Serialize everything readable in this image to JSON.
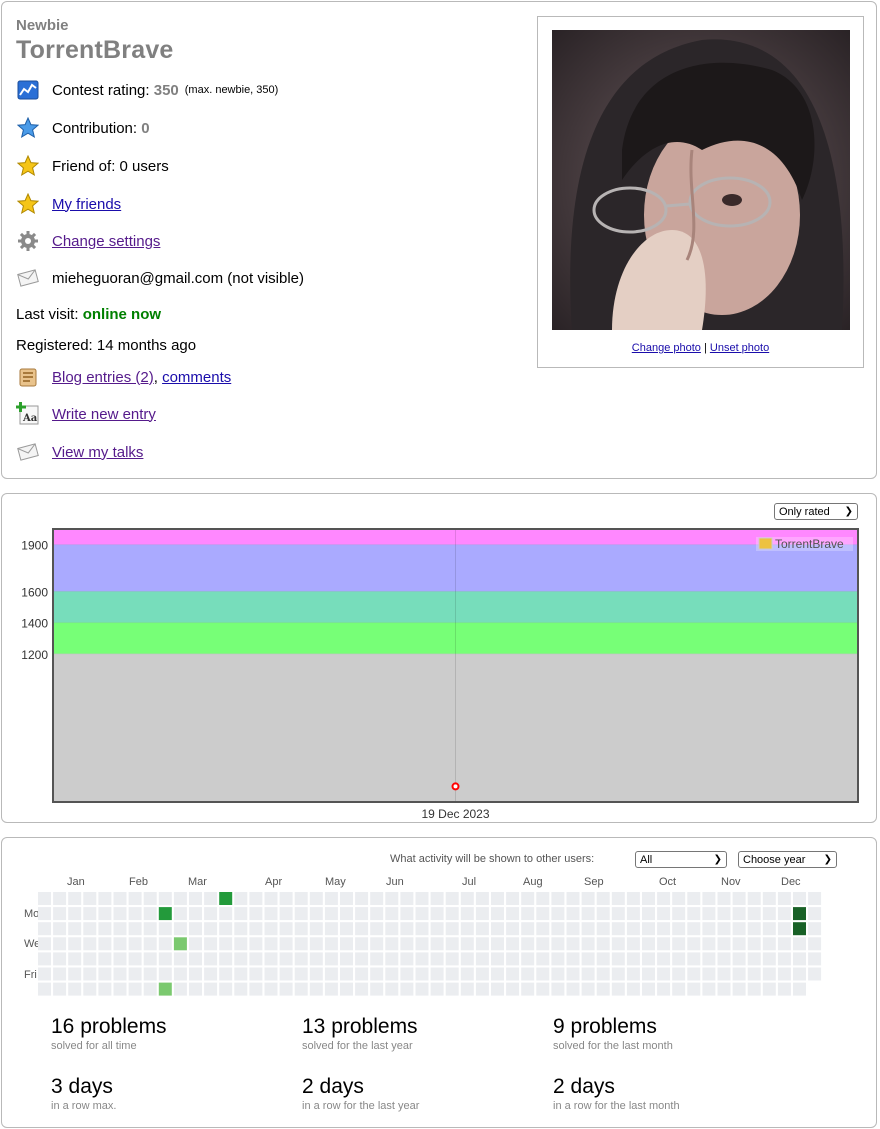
{
  "profile": {
    "rank": "Newbie",
    "handle": "TorrentBrave",
    "contest_rating_label": "Contest rating:",
    "contest_rating_value": "350",
    "contest_rating_max": "(max. newbie, 350)",
    "contribution_label": "Contribution:",
    "contribution_value": "0",
    "friend_of": "Friend of: 0 users",
    "my_friends": "My friends",
    "change_settings": "Change settings",
    "email": "mieheguoran@gmail.com (not visible)",
    "last_visit_label": "Last visit:",
    "last_visit_value": "online now",
    "registered": "Registered: 14 months ago",
    "blog_entries": "Blog entries (2)",
    "comma": ",",
    "comments": "comments",
    "write_new_entry": "Write new entry",
    "view_talks": "View my talks",
    "change_photo": "Change photo",
    "photo_sep": "|",
    "unset_photo": "Unset photo"
  },
  "rating": {
    "filter": "Only rated",
    "legend": "TorrentBrave",
    "date_label": "19 Dec 2023",
    "colors": {
      "pink": "#ff88ff",
      "violet": "#aaaaff",
      "teal": "#77ddbb",
      "green": "#77ff77",
      "grey": "#cccccc",
      "point": "#ff0000",
      "legend_swatch": "#edc240"
    }
  },
  "activity": {
    "question": "What activity will be shown to other users:",
    "visibility": "All",
    "year_select": "Choose year",
    "months": [
      "Jan",
      "Feb",
      "Mar",
      "Apr",
      "May",
      "Jun",
      "Jul",
      "Aug",
      "Sep",
      "Oct",
      "Nov",
      "Dec"
    ],
    "days": [
      "Mon",
      "Wed",
      "Fri"
    ],
    "colors": {
      "empty": "#ebedf0",
      "light": "#7bc96f",
      "mid": "#239a3b",
      "dark": "#196127"
    },
    "stats": [
      {
        "value": "16 problems",
        "caption": "solved for all time"
      },
      {
        "value": "13 problems",
        "caption": "solved for the last year"
      },
      {
        "value": "9 problems",
        "caption": "solved for the last month"
      },
      {
        "value": "3 days",
        "caption": "in a row max."
      },
      {
        "value": "2 days",
        "caption": "in a row for the last year"
      },
      {
        "value": "2 days",
        "caption": "in a row for the last month"
      }
    ]
  },
  "chart_data": {
    "type": "line",
    "series": [
      {
        "name": "TorrentBrave",
        "x": [
          "19 Dec 2023"
        ],
        "values": [
          350
        ]
      }
    ],
    "yticks": [
      1200,
      1400,
      1600,
      1900
    ],
    "bands": [
      {
        "from": 2100,
        "to": 1900,
        "color": "#ff88ff"
      },
      {
        "from": 1900,
        "to": 1600,
        "color": "#aaaaff"
      },
      {
        "from": 1600,
        "to": 1400,
        "color": "#77ddbb"
      },
      {
        "from": 1400,
        "to": 1200,
        "color": "#77ff77"
      },
      {
        "from": 1200,
        "to": 250,
        "color": "#cccccc"
      }
    ],
    "ylim": [
      250,
      2000
    ],
    "xlabel": "",
    "ylabel": "",
    "title": "",
    "legend_position": "top-right"
  }
}
